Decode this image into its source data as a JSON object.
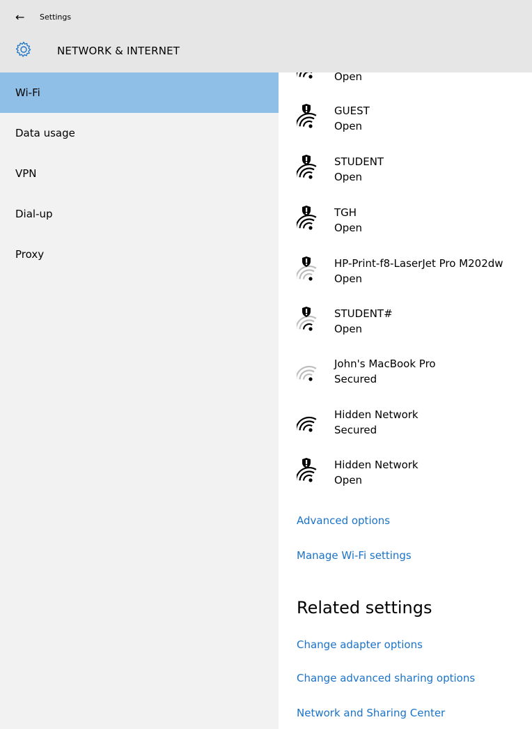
{
  "window": {
    "back_glyph": "←",
    "app_title": "Settings"
  },
  "header": {
    "title": "NETWORK & INTERNET"
  },
  "sidebar": {
    "items": [
      {
        "label": "Wi-Fi",
        "selected": true
      },
      {
        "label": "Data usage",
        "selected": false
      },
      {
        "label": "VPN",
        "selected": false
      },
      {
        "label": "Dial-up",
        "selected": false
      },
      {
        "label": "Proxy",
        "selected": false
      }
    ]
  },
  "networks": {
    "partial": {
      "status": "Open"
    },
    "items": [
      {
        "name": "GUEST",
        "status": "Open",
        "shield": true,
        "strength": 4
      },
      {
        "name": "STUDENT",
        "status": "Open",
        "shield": true,
        "strength": 4
      },
      {
        "name": "TGH",
        "status": "Open",
        "shield": true,
        "strength": 4
      },
      {
        "name": "HP-Print-f8-LaserJet Pro M202dw",
        "status": "Open",
        "shield": true,
        "strength": 1
      },
      {
        "name": "STUDENT#",
        "status": "Open",
        "shield": true,
        "strength": 2
      },
      {
        "name": "John's MacBook Pro",
        "status": "Secured",
        "shield": false,
        "strength": 1
      },
      {
        "name": "Hidden Network",
        "status": "Secured",
        "shield": false,
        "strength": 4
      },
      {
        "name": "Hidden Network",
        "status": "Open",
        "shield": true,
        "strength": 4
      }
    ]
  },
  "links": {
    "advanced_options": "Advanced options",
    "manage_wifi": "Manage Wi-Fi settings"
  },
  "related": {
    "title": "Related settings",
    "links": [
      "Change adapter options",
      "Change advanced sharing options",
      "Network and Sharing Center"
    ]
  },
  "colors": {
    "link": "#1a73c9",
    "selected_nav": "#8fbfe6",
    "sidebar_bg": "#f2f2f2",
    "titlebar_bg": "#e6e6e6"
  }
}
